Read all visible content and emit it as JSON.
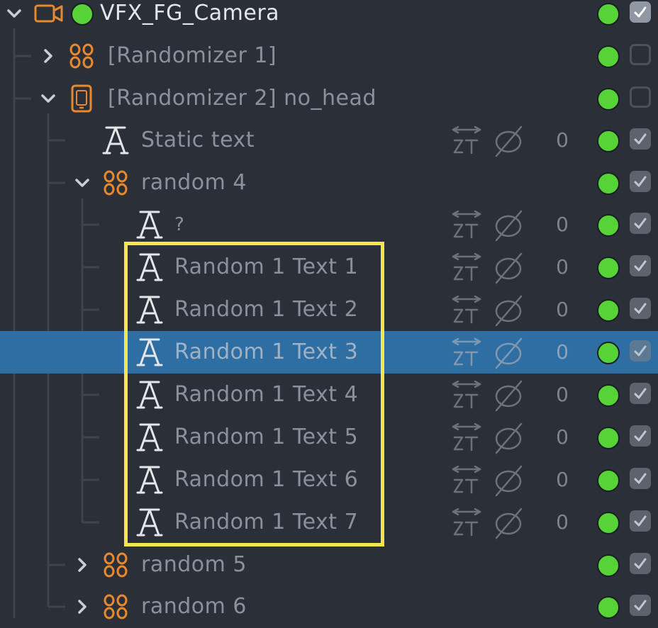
{
  "colors": {
    "background": "#2b3038",
    "selected_row": "#2f6ea3",
    "orange_icon": "#e8892f",
    "visibility_green": "#56d337",
    "highlight_box": "#f4e64c"
  },
  "tree": [
    {
      "label": "VFX_FG_Camera",
      "icon": "camera-icon",
      "expanded": true,
      "has_toggle": true,
      "has_status_dot": true,
      "checked": true
    },
    {
      "label": "[Randomizer 1]",
      "icon": "randomizer-icon",
      "expanded": false,
      "has_toggle": true,
      "checked": false
    },
    {
      "label": "[Randomizer 2] no_head",
      "icon": "device-icon",
      "expanded": true,
      "has_toggle": true,
      "checked": false
    },
    {
      "label": "Static text",
      "icon": "text-icon",
      "has_toggle": false,
      "value": "0",
      "checked": true
    },
    {
      "label": "random 4",
      "icon": "randomizer-icon",
      "expanded": true,
      "has_toggle": true,
      "checked": true
    },
    {
      "label": "?",
      "icon": "text-icon",
      "has_toggle": false,
      "value": "0",
      "checked": true
    },
    {
      "label": "Random 1 Text 1",
      "icon": "text-icon",
      "has_toggle": false,
      "value": "0",
      "checked": true
    },
    {
      "label": "Random 1 Text 2",
      "icon": "text-icon",
      "has_toggle": false,
      "value": "0",
      "checked": true
    },
    {
      "label": "Random 1 Text 3",
      "icon": "text-icon",
      "has_toggle": false,
      "value": "0",
      "checked": true,
      "selected": true
    },
    {
      "label": "Random 1 Text 4",
      "icon": "text-icon",
      "has_toggle": false,
      "value": "0",
      "checked": true
    },
    {
      "label": "Random 1 Text 5",
      "icon": "text-icon",
      "has_toggle": false,
      "value": "0",
      "checked": true
    },
    {
      "label": "Random 1 Text 6",
      "icon": "text-icon",
      "has_toggle": false,
      "value": "0",
      "checked": true
    },
    {
      "label": "Random 1 Text 7",
      "icon": "text-icon",
      "has_toggle": false,
      "value": "0",
      "checked": true
    },
    {
      "label": "random 5",
      "icon": "randomizer-icon",
      "expanded": false,
      "has_toggle": true,
      "checked": true
    },
    {
      "label": "random 6",
      "icon": "randomizer-icon",
      "expanded": false,
      "has_toggle": true,
      "checked": true
    }
  ]
}
